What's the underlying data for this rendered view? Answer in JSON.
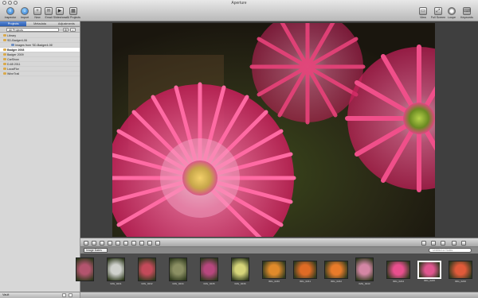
{
  "window": {
    "title": "Aperture"
  },
  "toolbar": {
    "left": [
      {
        "label": "Inspector",
        "icon": "info-icon"
      },
      {
        "label": "Import",
        "icon": "import-icon"
      },
      {
        "label": "New",
        "icon": "new-icon"
      },
      {
        "label": "Email",
        "icon": "email-icon"
      },
      {
        "label": "Slideshow",
        "icon": "slideshow-icon"
      },
      {
        "label": "All Projects",
        "icon": "all-projects-icon"
      }
    ],
    "right": [
      {
        "label": "View",
        "icon": "view-icon"
      },
      {
        "label": "Full Screen",
        "icon": "fullscreen-icon"
      },
      {
        "label": "Loupe",
        "icon": "loupe-icon"
      },
      {
        "label": "Keywords",
        "icon": "keywords-icon"
      }
    ]
  },
  "sidebar": {
    "tabs": [
      {
        "label": "Projects",
        "active": true
      },
      {
        "label": "Metadata",
        "active": false
      },
      {
        "label": "Adjustments",
        "active": false
      }
    ],
    "project_select": "All Projects",
    "items": [
      {
        "label": "Library",
        "level": 0,
        "selected": false
      },
      {
        "label": "SD-Badger4-06",
        "level": 0,
        "selected": false
      },
      {
        "label": "Images from 'SD-Badger4-06'",
        "level": 1,
        "selected": false
      },
      {
        "label": "Badger 2008",
        "level": 0,
        "selected": true
      },
      {
        "label": "Badger 2009",
        "level": 0,
        "selected": false
      },
      {
        "label": "CarShow",
        "level": 0,
        "selected": false
      },
      {
        "label": "D-65 2011",
        "level": 0,
        "selected": false
      },
      {
        "label": "LocalFlor",
        "level": 0,
        "selected": false
      },
      {
        "label": "WineTrail",
        "level": 0,
        "selected": false
      }
    ],
    "vault_label": "Vault"
  },
  "filmstrip": {
    "image_select": "Image Dates",
    "search_placeholder": "Untitled or Notes",
    "thumbs": [
      {
        "meta": "",
        "tint": "#b3546e",
        "orient": "portrait",
        "selected": false
      },
      {
        "meta": "IMG_0231",
        "tint": "#cfd1cd",
        "orient": "portrait",
        "selected": false
      },
      {
        "meta": "IMG_0232",
        "tint": "#c34a5a",
        "orient": "portrait",
        "selected": false
      },
      {
        "meta": "IMG_0234",
        "tint": "#8b8f63",
        "orient": "portrait",
        "selected": false
      },
      {
        "meta": "IMG_0235",
        "tint": "#b7477e",
        "orient": "portrait",
        "selected": false
      },
      {
        "meta": "IMG_0236",
        "tint": "#d6d57a",
        "orient": "portrait",
        "selected": false
      },
      {
        "meta": "IMG_0240",
        "tint": "#e08a2b",
        "orient": "landscape",
        "selected": false
      },
      {
        "meta": "IMG_0241",
        "tint": "#e06b25",
        "orient": "landscape",
        "selected": false
      },
      {
        "meta": "IMG_0242",
        "tint": "#e97b2a",
        "orient": "landscape",
        "selected": false
      },
      {
        "meta": "IMG_0243",
        "tint": "#d486a5",
        "orient": "portrait",
        "selected": false
      },
      {
        "meta": "IMG_0244",
        "tint": "#e84f8e",
        "orient": "landscape",
        "selected": false
      },
      {
        "meta": "IMG_0245",
        "tint": "#e0568f",
        "orient": "landscape",
        "selected": true
      },
      {
        "meta": "IMG_0246",
        "tint": "#e05a3a",
        "orient": "landscape",
        "selected": false
      }
    ]
  },
  "colors": {
    "accent": "#2a5cb1",
    "flower": "#e8427a"
  }
}
